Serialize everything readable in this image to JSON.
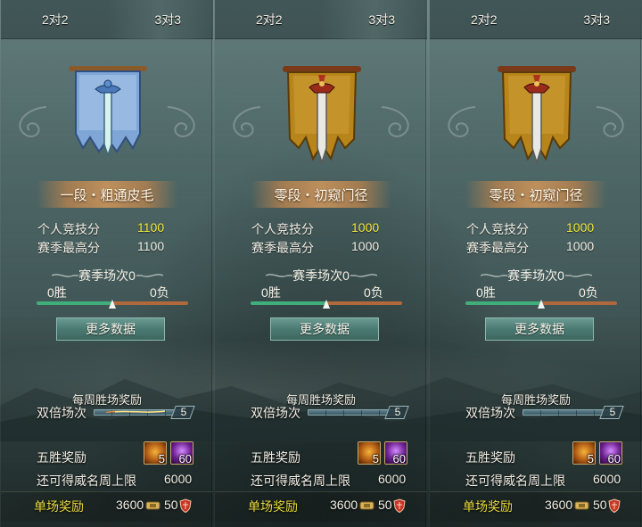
{
  "panels": [
    {
      "tabs": [
        "2对2",
        "3对3"
      ],
      "active_tab": 1,
      "banner": "blue-sword-banner",
      "rank_name": "一段・粗通皮毛",
      "personal_score_label": "个人竞技分",
      "personal_score_value": "1100",
      "season_best_label": "赛季最高分",
      "season_best_value": "1100",
      "season_matches_label": "赛季场次0",
      "wins_label": "0胜",
      "losses_label": "0负",
      "win_ratio": 0.5,
      "more_data_label": "更多数据",
      "weekly_reward_title": "每周胜场奖励",
      "double_matches_label": "双倍场次",
      "double_matches_value": "5",
      "double_fire": true,
      "five_win_label": "五胜奖励",
      "five_win_items": [
        {
          "icon": "gold-treasure-icon",
          "count": "5"
        },
        {
          "icon": "purple-essence-icon",
          "count": "60"
        }
      ],
      "weekly_cap_label": "还可得威名周上限",
      "weekly_cap_value": "6000",
      "single_reward_label": "单场奖励",
      "single_reward_coins": "3600",
      "single_reward_shield": "50"
    },
    {
      "tabs": [
        "2对2",
        "3对3"
      ],
      "active_tab": 1,
      "banner": "gold-sword-banner",
      "rank_name": "零段・初窥门径",
      "personal_score_label": "个人竞技分",
      "personal_score_value": "1000",
      "season_best_label": "赛季最高分",
      "season_best_value": "1000",
      "season_matches_label": "赛季场次0",
      "wins_label": "0胜",
      "losses_label": "0负",
      "win_ratio": 0.5,
      "more_data_label": "更多数据",
      "weekly_reward_title": "每周胜场奖励",
      "double_matches_label": "双倍场次",
      "double_matches_value": "5",
      "double_fire": false,
      "five_win_label": "五胜奖励",
      "five_win_items": [
        {
          "icon": "gold-treasure-icon",
          "count": "5"
        },
        {
          "icon": "purple-essence-icon",
          "count": "60"
        }
      ],
      "weekly_cap_label": "还可得威名周上限",
      "weekly_cap_value": "6000",
      "single_reward_label": "单场奖励",
      "single_reward_coins": "3600",
      "single_reward_shield": "50"
    },
    {
      "tabs": [
        "2对2",
        "3对3"
      ],
      "active_tab": -1,
      "banner": "gold-sword-banner",
      "rank_name": "零段・初窥门径",
      "personal_score_label": "个人竞技分",
      "personal_score_value": "1000",
      "season_best_label": "赛季最高分",
      "season_best_value": "1000",
      "season_matches_label": "赛季场次0",
      "wins_label": "0胜",
      "losses_label": "0负",
      "win_ratio": 0.5,
      "more_data_label": "更多数据",
      "weekly_reward_title": "每周胜场奖励",
      "double_matches_label": "双倍场次",
      "double_matches_value": "5",
      "double_fire": false,
      "five_win_label": "五胜奖励",
      "five_win_items": [
        {
          "icon": "gold-treasure-icon",
          "count": "5"
        },
        {
          "icon": "purple-essence-icon",
          "count": "60"
        }
      ],
      "weekly_cap_label": "还可得威名周上限",
      "weekly_cap_value": "6000",
      "single_reward_label": "单场奖励",
      "single_reward_coins": "3600",
      "single_reward_shield": "50"
    }
  ],
  "colors": {
    "score_yellow": "#f3ea3b",
    "reward_yellow": "#e8d83a",
    "win_green": "#3fae7a",
    "loss_orange": "#b0683d",
    "button_teal": "#4b7a72",
    "rank_plate": "#c4925c"
  }
}
